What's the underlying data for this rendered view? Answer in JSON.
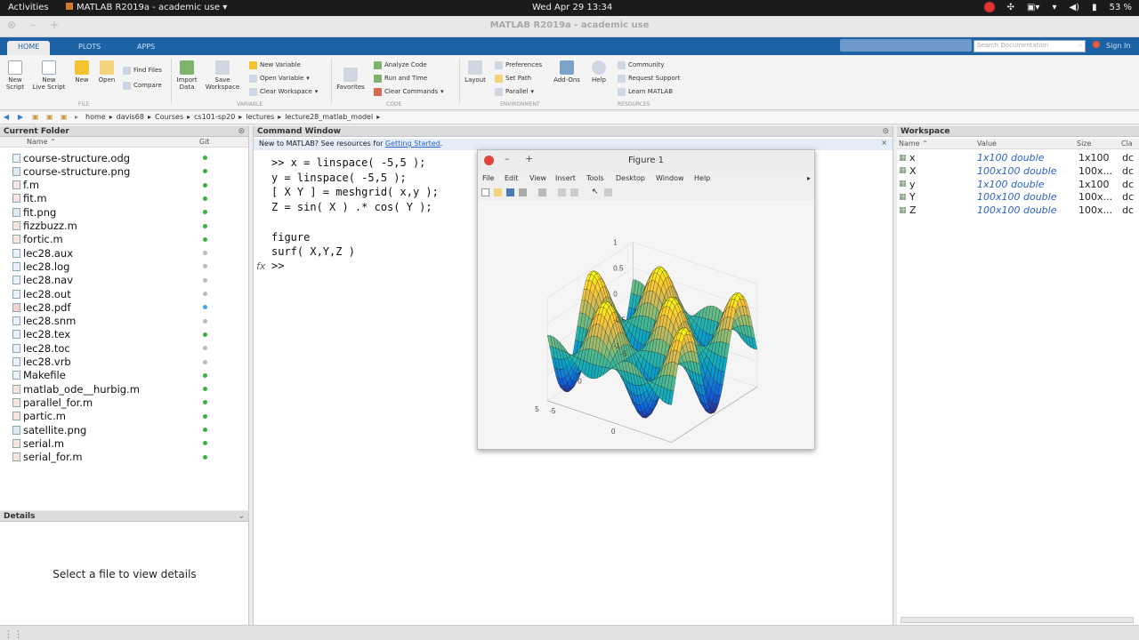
{
  "topbar": {
    "activities": "Activities",
    "app_title": "MATLAB R2019a - academic use",
    "clock": "Wed Apr 29  13:34",
    "battery": "53 %"
  },
  "window": {
    "title": "MATLAB R2019a - academic use"
  },
  "tabs": [
    "HOME",
    "PLOTS",
    "APPS"
  ],
  "search_placeholder": "Search Documentation",
  "sign_in": "Sign In",
  "ribbon": {
    "new_script": "New\nScript",
    "new_live_script": "New\nLive Script",
    "new": "New",
    "open": "Open",
    "find_files": "Find Files",
    "compare": "Compare",
    "import_data": "Import\nData",
    "save_workspace": "Save\nWorkspace",
    "new_variable": "New Variable",
    "open_variable": "Open Variable",
    "clear_workspace": "Clear Workspace",
    "favorites": "Favorites",
    "analyze_code": "Analyze Code",
    "run_and_time": "Run and Time",
    "clear_commands": "Clear Commands",
    "layout": "Layout",
    "preferences": "Preferences",
    "set_path": "Set Path",
    "parallel": "Parallel",
    "add_ons": "Add-Ons",
    "help": "Help",
    "community": "Community",
    "request_support": "Request Support",
    "learn_matlab": "Learn MATLAB",
    "sections": [
      "FILE",
      "VARIABLE",
      "CODE",
      "ENVIRONMENT",
      "RESOURCES"
    ]
  },
  "address": [
    "home",
    "davis68",
    "Courses",
    "cs101-sp20",
    "lectures",
    "lecture28_matlab_model"
  ],
  "current_folder": {
    "title": "Current Folder",
    "col_name": "Name",
    "col_git": "Git",
    "files": [
      {
        "name": "course-structure.odg",
        "icon": "doc",
        "git": "#3cb043"
      },
      {
        "name": "course-structure.png",
        "icon": "image",
        "git": "#3cb043"
      },
      {
        "name": "f.m",
        "icon": "mfile",
        "git": "#3cb043"
      },
      {
        "name": "fit.m",
        "icon": "mfile",
        "git": "#3cb043"
      },
      {
        "name": "fit.png",
        "icon": "image",
        "git": "#3cb043"
      },
      {
        "name": "fizzbuzz.m",
        "icon": "mfile",
        "git": "#3cb043"
      },
      {
        "name": "fortic.m",
        "icon": "mfile",
        "git": "#3cb043"
      },
      {
        "name": "lec28.aux",
        "icon": "doc",
        "git": "#bbbbbb"
      },
      {
        "name": "lec28.log",
        "icon": "doc",
        "git": "#bbbbbb"
      },
      {
        "name": "lec28.nav",
        "icon": "doc",
        "git": "#bbbbbb"
      },
      {
        "name": "lec28.out",
        "icon": "doc",
        "git": "#bbbbbb"
      },
      {
        "name": "lec28.pdf",
        "icon": "pdf",
        "git": "#4aa3e8"
      },
      {
        "name": "lec28.snm",
        "icon": "doc",
        "git": "#bbbbbb"
      },
      {
        "name": "lec28.tex",
        "icon": "doc",
        "git": "#3cb043"
      },
      {
        "name": "lec28.toc",
        "icon": "doc",
        "git": "#bbbbbb"
      },
      {
        "name": "lec28.vrb",
        "icon": "doc",
        "git": "#bbbbbb"
      },
      {
        "name": "Makefile",
        "icon": "doc",
        "git": "#3cb043"
      },
      {
        "name": "matlab_ode__hurbig.m",
        "icon": "mfile",
        "git": "#3cb043"
      },
      {
        "name": "parallel_for.m",
        "icon": "mfile",
        "git": "#3cb043"
      },
      {
        "name": "partic.m",
        "icon": "mfile",
        "git": "#3cb043"
      },
      {
        "name": "satellite.png",
        "icon": "image",
        "git": "#3cb043"
      },
      {
        "name": "serial.m",
        "icon": "mfile",
        "git": "#3cb043"
      },
      {
        "name": "serial_for.m",
        "icon": "mfile",
        "git": "#3cb043"
      }
    ]
  },
  "details": {
    "title": "Details",
    "message": "Select a file to view details"
  },
  "command_window": {
    "title": "Command Window",
    "banner_text": "New to MATLAB? See resources for ",
    "banner_link": "Getting Started",
    "banner_end": ".",
    "lines": [
      "&gt;&gt; x = linspace( -5,5 );",
      "y = linspace( -5,5 );",
      "[ X Y ] = meshgrid( x,y );",
      "Z = sin( X ) .* cos( Y );",
      "",
      "figure",
      "surf( X,Y,Z )"
    ],
    "prompt": ">>",
    "fx": "fx"
  },
  "workspace": {
    "title": "Workspace",
    "col_name": "Name",
    "col_value": "Value",
    "col_size": "Size",
    "col_class": "Cla",
    "vars": [
      {
        "name": "x",
        "value": "1x100 double",
        "size": "1x100",
        "cls": "dc"
      },
      {
        "name": "X",
        "value": "100x100 double",
        "size": "100x...",
        "cls": "dc"
      },
      {
        "name": "y",
        "value": "1x100 double",
        "size": "1x100",
        "cls": "dc"
      },
      {
        "name": "Y",
        "value": "100x100 double",
        "size": "100x...",
        "cls": "dc"
      },
      {
        "name": "Z",
        "value": "100x100 double",
        "size": "100x...",
        "cls": "dc"
      }
    ]
  },
  "figure": {
    "title": "Figure 1",
    "menu": [
      "File",
      "Edit",
      "View",
      "Insert",
      "Tools",
      "Desktop",
      "Window",
      "Help"
    ],
    "zticks": [
      "1",
      "0.5",
      "0",
      "-0.5",
      "-1"
    ],
    "yticks": [
      "5",
      "0",
      "-5"
    ],
    "xticks": [
      "-5",
      "0",
      "5"
    ]
  },
  "colors": {
    "accent": "#1e62a6",
    "link": "#2a62c9",
    "close": "#e0443a"
  }
}
